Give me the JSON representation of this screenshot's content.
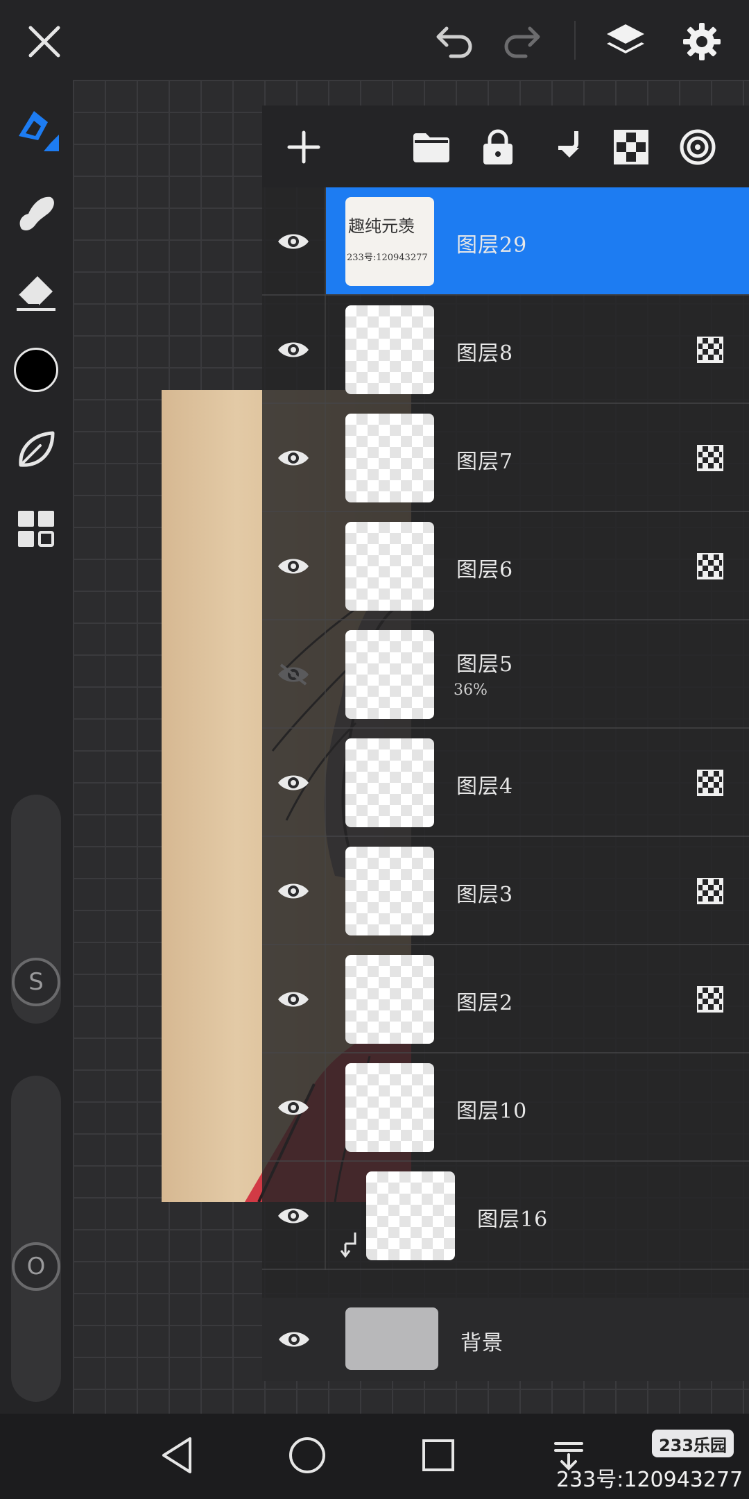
{
  "colors": {
    "accent": "#1d7cf2",
    "toolbar_bg": "#242426",
    "panel_bg": "#242426",
    "canvas_bg": "#2c2c2e",
    "brush_color": "#000000"
  },
  "toolbar": {
    "close_icon": "close-icon",
    "undo_icon": "undo-icon",
    "redo_icon": "redo-icon",
    "layers_icon": "layers-icon",
    "settings_icon": "gear-icon"
  },
  "left_tools": [
    {
      "name": "brush-tool",
      "icon": "brush-icon",
      "active": true
    },
    {
      "name": "smudge-tool",
      "icon": "smudge-icon",
      "active": false
    },
    {
      "name": "eraser-tool",
      "icon": "eraser-icon",
      "active": false
    },
    {
      "name": "color-swatch",
      "icon": "color-swatch-icon",
      "active": false
    },
    {
      "name": "brush-library",
      "icon": "leaf-icon",
      "active": false
    },
    {
      "name": "gallery",
      "icon": "grid-icon",
      "active": false
    }
  ],
  "sliders": {
    "size_label": "S",
    "opacity_label": "O"
  },
  "layers_toolbar": [
    {
      "name": "add-layer-button",
      "icon": "plus-icon"
    },
    {
      "name": "layer-folder-button",
      "icon": "folder-icon"
    },
    {
      "name": "layer-lock-button",
      "icon": "lock-icon"
    },
    {
      "name": "merge-down-button",
      "icon": "merge-down-icon"
    },
    {
      "name": "alpha-lock-button",
      "icon": "checker-icon"
    },
    {
      "name": "blend-mode-button",
      "icon": "target-icon"
    }
  ],
  "layers": [
    {
      "name": "图层29",
      "visible": true,
      "selected": true,
      "alpha_lock": false,
      "opacity": "",
      "thumb": "solid",
      "clipped": false
    },
    {
      "name": "图层8",
      "visible": true,
      "selected": false,
      "alpha_lock": true,
      "opacity": "",
      "thumb": "checker",
      "clipped": false
    },
    {
      "name": "图层7",
      "visible": true,
      "selected": false,
      "alpha_lock": true,
      "opacity": "",
      "thumb": "checker",
      "clipped": false
    },
    {
      "name": "图层6",
      "visible": true,
      "selected": false,
      "alpha_lock": true,
      "opacity": "",
      "thumb": "checker",
      "clipped": false
    },
    {
      "name": "图层5",
      "visible": false,
      "selected": false,
      "alpha_lock": false,
      "opacity": "36%",
      "thumb": "checker",
      "clipped": false
    },
    {
      "name": "图层4",
      "visible": true,
      "selected": false,
      "alpha_lock": true,
      "opacity": "",
      "thumb": "checker",
      "clipped": false
    },
    {
      "name": "图层3",
      "visible": true,
      "selected": false,
      "alpha_lock": true,
      "opacity": "",
      "thumb": "checker",
      "clipped": false
    },
    {
      "name": "图层2",
      "visible": true,
      "selected": false,
      "alpha_lock": true,
      "opacity": "",
      "thumb": "checker",
      "clipped": false
    },
    {
      "name": "图层10",
      "visible": true,
      "selected": false,
      "alpha_lock": false,
      "opacity": "",
      "thumb": "checker",
      "clipped": false
    },
    {
      "name": "图层16",
      "visible": true,
      "selected": false,
      "alpha_lock": false,
      "opacity": "",
      "thumb": "checker",
      "clipped": true
    }
  ],
  "background_layer": {
    "name": "背景",
    "visible": true
  },
  "layer29_thumb_text": [
    "趣纯元羡",
    "233号:120943277"
  ],
  "nav": {
    "back_icon": "back-triangle-icon",
    "home_icon": "home-circle-icon",
    "recents_icon": "recents-square-icon",
    "menu_icon": "menu-down-icon"
  },
  "watermark": {
    "badge": "233乐园",
    "text": "233号:120943277"
  }
}
